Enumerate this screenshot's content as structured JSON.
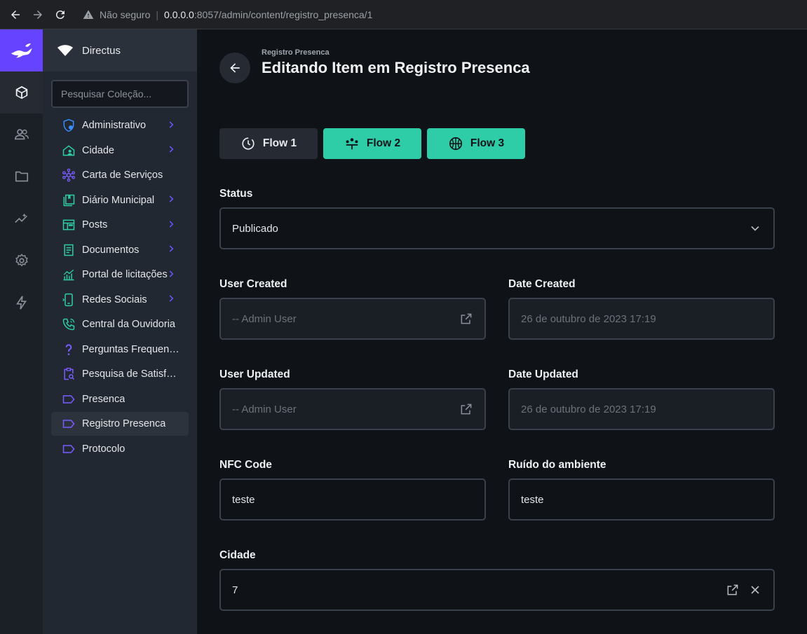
{
  "browser": {
    "security": "Não seguro",
    "url_host": "0.0.0.0",
    "url_path": ":8057/admin/content/registro_presenca/1"
  },
  "project": {
    "name": "Directus"
  },
  "search": {
    "placeholder": "Pesquisar Coleção..."
  },
  "nav": [
    {
      "label": "Administrativo",
      "icon": "admin-shield-icon",
      "chevron": true
    },
    {
      "label": "Cidade",
      "icon": "home-person-icon",
      "chevron": true
    },
    {
      "label": "Carta de Serviços",
      "icon": "hub-icon",
      "chevron": false
    },
    {
      "label": "Diário Municipal",
      "icon": "book-stack-icon",
      "chevron": true
    },
    {
      "label": "Posts",
      "icon": "web-layout-icon",
      "chevron": true
    },
    {
      "label": "Documentos",
      "icon": "document-icon",
      "chevron": true
    },
    {
      "label": "Portal de licitações",
      "icon": "chart-icon",
      "chevron": true
    },
    {
      "label": "Redes Sociais",
      "icon": "phone-icon",
      "chevron": true
    },
    {
      "label": "Central da Ouvidoria",
      "icon": "phone-call-icon",
      "chevron": false
    },
    {
      "label": "Perguntas Frequentes",
      "icon": "question-icon",
      "chevron": false
    },
    {
      "label": "Pesquisa de Satisfação",
      "icon": "clipboard-search-icon",
      "chevron": false
    },
    {
      "label": "Presenca",
      "icon": "label-icon",
      "chevron": false
    },
    {
      "label": "Registro Presenca",
      "icon": "label-icon",
      "chevron": false,
      "active": true
    },
    {
      "label": "Protocolo",
      "icon": "label-icon",
      "chevron": false
    }
  ],
  "header": {
    "breadcrumb": "Registro Presenca",
    "title": "Editando Item em Registro Presenca"
  },
  "flows": [
    {
      "label": "Flow 1",
      "style": "dark"
    },
    {
      "label": "Flow 2",
      "style": "teal"
    },
    {
      "label": "Flow 3",
      "style": "teal"
    }
  ],
  "fields": {
    "status": {
      "label": "Status",
      "value": "Publicado"
    },
    "user_created": {
      "label": "User Created",
      "value": "-- Admin User"
    },
    "date_created": {
      "label": "Date Created",
      "value": "26 de outubro de 2023 17:19"
    },
    "user_updated": {
      "label": "User Updated",
      "value": "-- Admin User"
    },
    "date_updated": {
      "label": "Date Updated",
      "value": "26 de outubro de 2023 17:19"
    },
    "nfc_code": {
      "label": "NFC Code",
      "value": "teste"
    },
    "ruido": {
      "label": "Ruído do ambiente",
      "value": "teste"
    },
    "cidade": {
      "label": "Cidade",
      "value": "7"
    }
  },
  "colors": {
    "accent": "#6644ff",
    "flow_teal": "#2ecda7",
    "background": "#0f1217"
  }
}
